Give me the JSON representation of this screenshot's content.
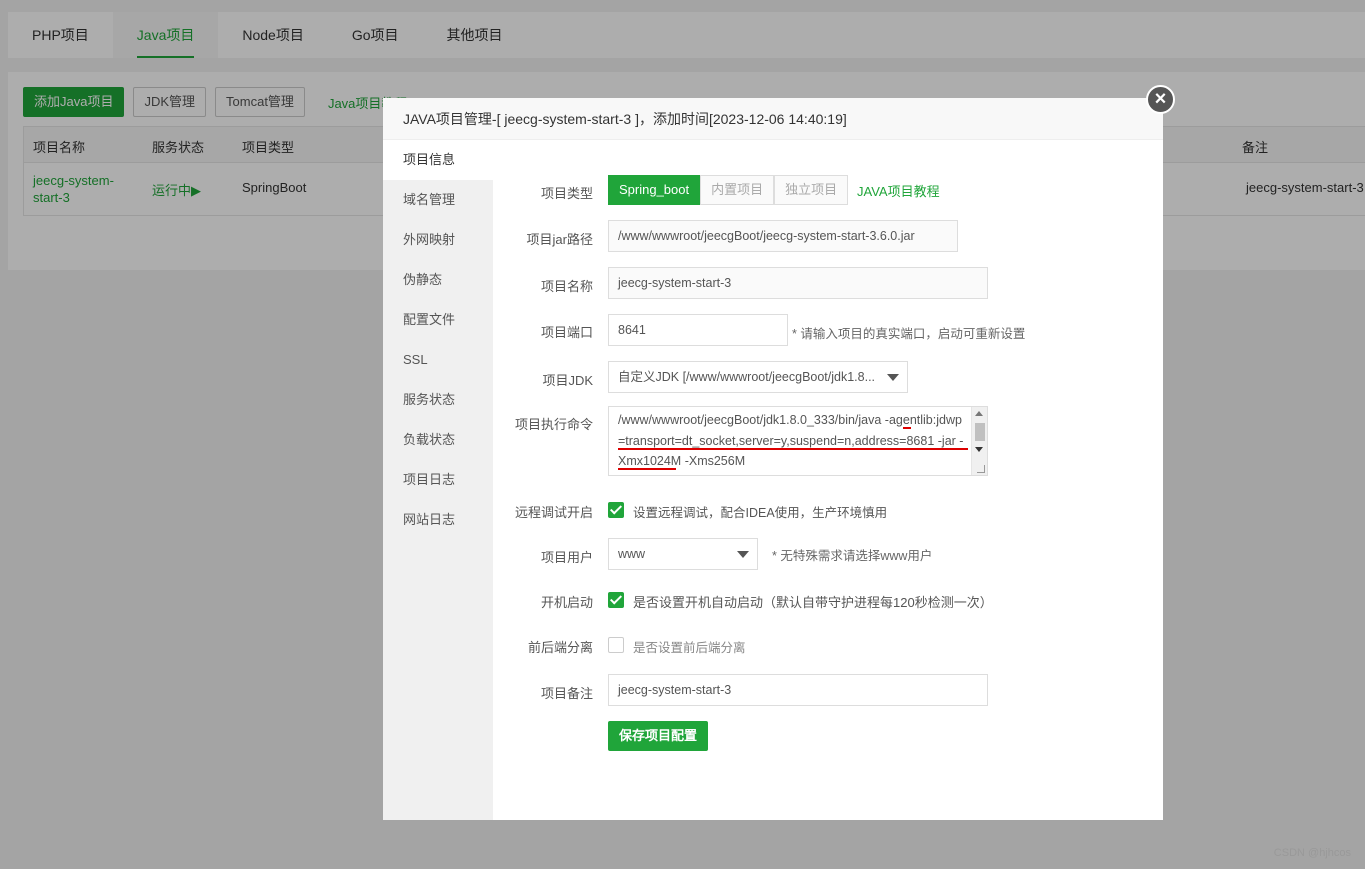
{
  "tabs": [
    "PHP项目",
    "Java项目",
    "Node项目",
    "Go项目",
    "其他项目"
  ],
  "toolbar": {
    "add_label": "添加Java项目",
    "jdk_label": "JDK管理",
    "tomcat_label": "Tomcat管理",
    "tutorial_label": "Java项目教程"
  },
  "table": {
    "headers": {
      "name": "项目名称",
      "status": "服务状态",
      "type": "项目类型",
      "remark": "备注"
    },
    "row": {
      "name": "jeecg-system-start-3",
      "status": "运行中▶",
      "type": "SpringBoot",
      "remark": "jeecg-system-start-3"
    }
  },
  "modal": {
    "title": "JAVA项目管理-[ jeecg-system-start-3 ]，添加时间[2023-12-06 14:40:19]",
    "close": "×",
    "side_nav": [
      "项目信息",
      "域名管理",
      "外网映射",
      "伪静态",
      "配置文件",
      "SSL",
      "服务状态",
      "负载状态",
      "项目日志",
      "网站日志"
    ],
    "form": {
      "type_label": "项目类型",
      "type_options": [
        "Spring_boot",
        "内置项目",
        "独立项目"
      ],
      "type_tutorial": "JAVA项目教程",
      "jar_label": "项目jar路径",
      "jar_value": "/www/wwwroot/jeecgBoot/jeecg-system-start-3.6.0.jar",
      "name_label": "项目名称",
      "name_value": "jeecg-system-start-3",
      "port_label": "项目端口",
      "port_value": "8641",
      "port_hint": "* 请输入项目的真实端口，启动可重新设置",
      "jdk_label": "项目JDK",
      "jdk_value": "自定义JDK [/www/wwwroot/jeecgBoot/jdk1.8...",
      "cmd_label": "项目执行命令",
      "cmd_value": "/www/wwwroot/jeecgBoot/jdk1.8.0_333/bin/java -agentlib:jdwp=transport=dt_socket,server=y,suspend=n,address=8681 -jar -Xmx1024M -Xms256M",
      "debug_label": "远程调试开启",
      "debug_text": "设置远程调试，配合IDEA使用，生产环境慎用",
      "user_label": "项目用户",
      "user_value": "www",
      "user_hint": "* 无特殊需求请选择www用户",
      "boot_label": "开机启动",
      "boot_text": "是否设置开机自动启动（默认自带守护进程每120秒检测一次）",
      "split_label": "前后端分离",
      "split_text": "是否设置前后端分离",
      "remark_label": "项目备注",
      "remark_value": "jeecg-system-start-3",
      "save_label": "保存项目配置"
    }
  },
  "watermark": "CSDN @hjhcos",
  "colors": {
    "accent": "#20a53a",
    "annotation": "#dd0000"
  }
}
